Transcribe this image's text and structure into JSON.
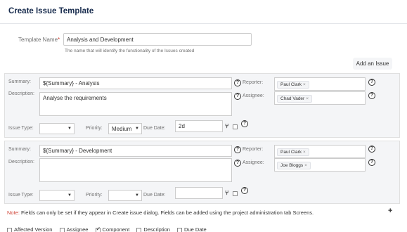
{
  "page": {
    "title": "Create Issue Template"
  },
  "template": {
    "name_label": "Template Name",
    "required_mark": "*",
    "name_value": "Analysis and Development",
    "hint": "The name that will identify the functionality of the Issues created"
  },
  "actions": {
    "add_issue": "Add an Issue"
  },
  "labels": {
    "summary": "Summary:",
    "description": "Description:",
    "issue_type": "Issue Type:",
    "priority": "Priority:",
    "due_date": "Due Date:",
    "reporter": "Reporter:",
    "assignee": "Assignee:",
    "help": "?",
    "chip_remove": "×",
    "branch": "⑂"
  },
  "issues": [
    {
      "summary": "${Summary} - Analysis",
      "description": "Analyse the requirements",
      "issue_type": "",
      "priority": "Medium",
      "due_date": "2d",
      "reporter": "Paul Clark",
      "assignee": "Chad Vader"
    },
    {
      "summary": "${Summary} - Development",
      "description": "",
      "issue_type": "",
      "priority": "",
      "due_date": "",
      "reporter": "Paul Clark",
      "assignee": "Joe Bloggs"
    }
  ],
  "note": {
    "key": "Note:",
    "text": "Fields can only be set if they appear in Create issue dialog. Fields can be added using the project administration tab Screens."
  },
  "fields_row": {
    "items": [
      {
        "label": "Affected Version",
        "checked": false
      },
      {
        "label": "Assignee",
        "checked": false
      },
      {
        "label": "Component",
        "checked": true
      },
      {
        "label": "Description",
        "checked": false
      },
      {
        "label": "Due Date",
        "checked": false
      }
    ]
  },
  "colors": {
    "accent_red": "#d04437",
    "panel_bg": "#f4f5f7",
    "title": "#172b4d"
  },
  "icons": {
    "help": "help-icon",
    "branch": "branch-icon",
    "add": "plus-icon"
  }
}
